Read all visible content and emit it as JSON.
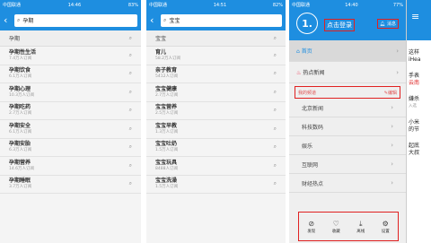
{
  "panel1": {
    "status": {
      "carrier": "中国联通",
      "time": "14:46",
      "battery": "83%"
    },
    "search_value": "孕期",
    "header": "孕期",
    "items": [
      {
        "title": "孕期性生活",
        "sub": "7.4万人订阅"
      },
      {
        "title": "孕期饮食",
        "sub": "6.1万人订阅"
      },
      {
        "title": "孕期心理",
        "sub": "10.3万人订阅"
      },
      {
        "title": "孕期吃药",
        "sub": "2.7万人订阅"
      },
      {
        "title": "孕期安全",
        "sub": "6.1万人订阅"
      },
      {
        "title": "孕期安胎",
        "sub": "6.3万人订阅"
      },
      {
        "title": "孕期营养",
        "sub": "14.6万人订阅"
      },
      {
        "title": "孕期睡眠",
        "sub": "3.7万人订阅"
      }
    ]
  },
  "panel2": {
    "status": {
      "carrier": "中国联通",
      "time": "14:51",
      "battery": "82%"
    },
    "search_value": "宝宝",
    "header": "宝宝",
    "items": [
      {
        "title": "育儿",
        "sub": "58.2万人订阅"
      },
      {
        "title": "亲子教育",
        "sub": "5412人订阅"
      },
      {
        "title": "宝宝健康",
        "sub": "2.7万人订阅"
      },
      {
        "title": "宝宝营养",
        "sub": "2.5万人订阅"
      },
      {
        "title": "宝宝早教",
        "sub": "1.3万人订阅"
      },
      {
        "title": "宝宝吐奶",
        "sub": "1.5万人订阅"
      },
      {
        "title": "宝宝玩具",
        "sub": "8488人订阅"
      },
      {
        "title": "宝宝洗澡",
        "sub": "1.5万人订阅"
      }
    ]
  },
  "panel3": {
    "status": {
      "carrier": "中国联通",
      "time": "14:40",
      "battery": "77%"
    },
    "logo": "1.",
    "login": "点击登录",
    "message": "消息",
    "menu": [
      {
        "label": "首页"
      },
      {
        "label": "热点新闻"
      }
    ],
    "channel_header": {
      "title": "我的频道",
      "edit": "编辑"
    },
    "channels": [
      "北京新闻",
      "科技数码",
      "娱乐",
      "互联网",
      "财经热点"
    ],
    "bottom_nav": [
      "发现",
      "收藏",
      "离线",
      "设置"
    ],
    "side_texts": [
      "这样",
      "iHea",
      "手表",
      "云南",
      "嫌杀",
      "入选",
      "小米",
      "的节",
      "起底",
      "大叔"
    ]
  },
  "colors": {
    "brand": "#1e8ee0",
    "highlight": "#e02020"
  }
}
